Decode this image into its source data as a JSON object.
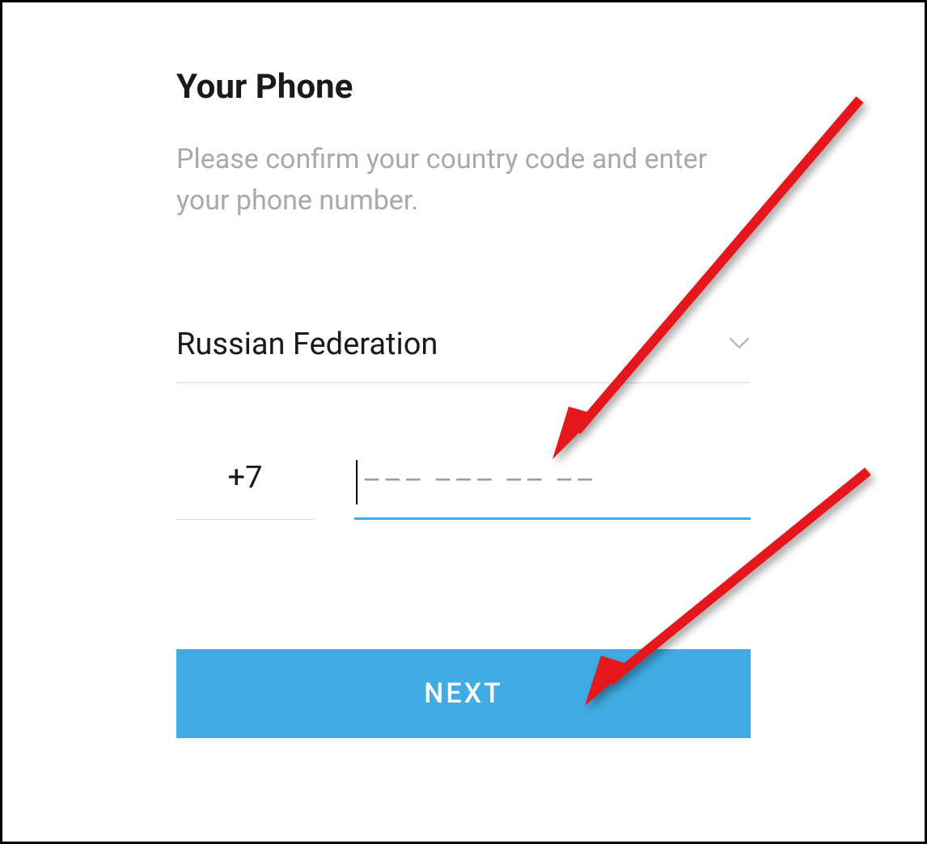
{
  "header": {
    "title": "Your Phone",
    "subtitle": "Please confirm your country code and enter your phone number."
  },
  "country": {
    "selected": "Russian Federation",
    "code": "+7"
  },
  "phone": {
    "value": "",
    "placeholder_mask": "––– ––– –– ––"
  },
  "buttons": {
    "next_label": "NEXT"
  },
  "colors": {
    "accent": "#40ace3",
    "text_primary": "#1a1a1a",
    "text_secondary": "#aaa9a8",
    "divider": "#d8d8d8"
  }
}
